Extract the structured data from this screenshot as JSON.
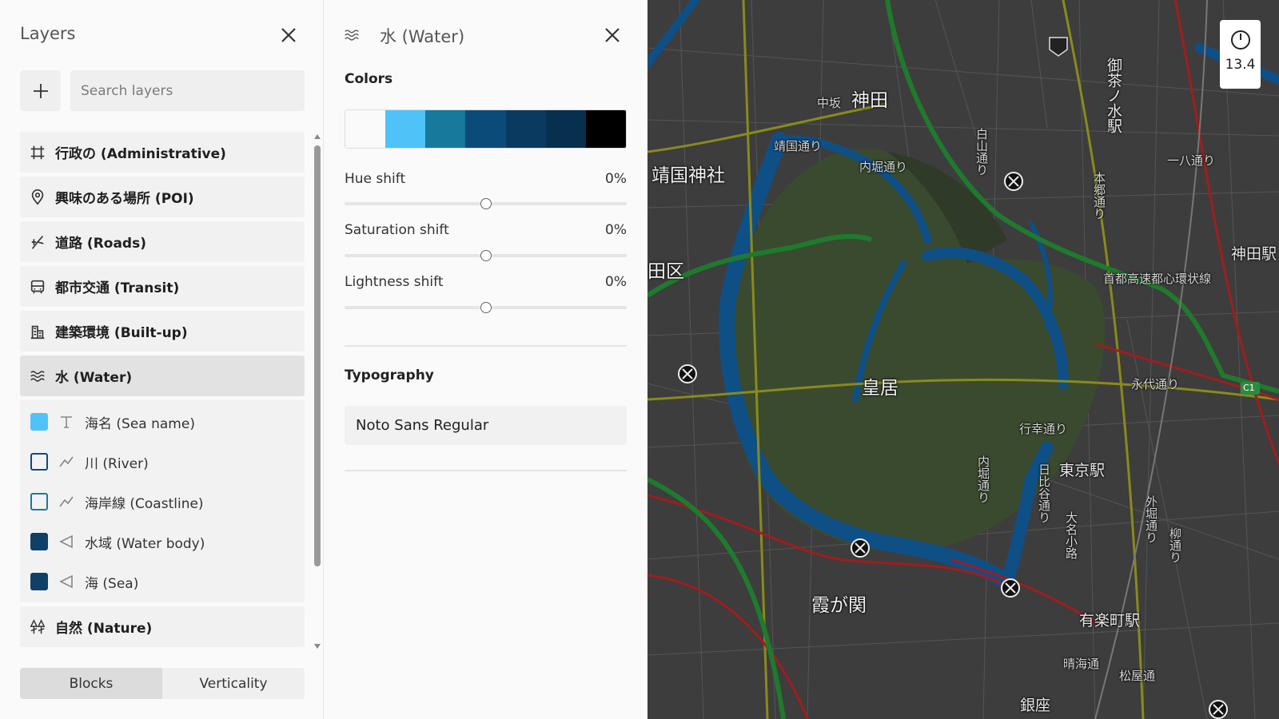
{
  "layers_panel": {
    "title": "Layers",
    "search_placeholder": "Search layers",
    "groups": [
      {
        "label": "行政の (Administrative)",
        "icon": "grid-hash-icon"
      },
      {
        "label": "興味のある場所 (POI)",
        "icon": "map-pin-icon"
      },
      {
        "label": "道路 (Roads)",
        "icon": "road-fork-icon"
      },
      {
        "label": "都市交通 (Transit)",
        "icon": "bus-icon"
      },
      {
        "label": "建築環境 (Built-up)",
        "icon": "buildings-icon"
      },
      {
        "label": "水 (Water)",
        "icon": "waves-icon",
        "active": true
      },
      {
        "label": "自然 (Nature)",
        "icon": "tree-icon"
      }
    ],
    "water_children": [
      {
        "label": "海名 (Sea name)",
        "type": "text-icon",
        "swatch_fill": "#4fc3f7",
        "swatch_border": "#4fc3f7"
      },
      {
        "label": "川 (River)",
        "type": "line-icon",
        "swatch_fill": "transparent",
        "swatch_border": "#0f4c75"
      },
      {
        "label": "海岸線 (Coastline)",
        "type": "line-icon",
        "swatch_fill": "transparent",
        "swatch_border": "#1b7a99"
      },
      {
        "label": "水域 (Water body)",
        "type": "polygon-icon",
        "swatch_fill": "#0e4068",
        "swatch_border": "#0e4068"
      },
      {
        "label": "海 (Sea)",
        "type": "polygon-icon",
        "swatch_fill": "#0e4068",
        "swatch_border": "#0e4068"
      }
    ],
    "modes": [
      "Blocks",
      "Verticality"
    ],
    "selected_mode": "Blocks"
  },
  "detail_panel": {
    "title": "水 (Water)",
    "colors_heading": "Colors",
    "palette": [
      "#fafafa",
      "#4fc3f7",
      "#17799b",
      "#0b4b7a",
      "#0a3a5f",
      "#07304f",
      "#000000"
    ],
    "sliders": [
      {
        "label": "Hue shift",
        "value": "0%",
        "level": 0.5
      },
      {
        "label": "Saturation shift",
        "value": "0%",
        "level": 0.5
      },
      {
        "label": "Lightness shift",
        "value": "0%",
        "level": 0.5
      }
    ],
    "typography_heading": "Typography",
    "font": "Noto Sans Regular"
  },
  "map": {
    "zoom": "13.4",
    "labels": {
      "kanda": "神田",
      "nakasaka": "中坂",
      "yasukuni": "靖国神社",
      "chiyoda": "田区",
      "imperial_palace": "皇居",
      "tokyo_station": "東京駅",
      "kasumigaseki": "霞が関",
      "yurakucho": "有楽町駅",
      "ginza": "銀座",
      "kanda_station": "神田駅",
      "ochanomizu": "御茶ノ水駅",
      "yasukuni_dori": "靖国通り",
      "uchibori": "内堀通り",
      "hakusan": "白山通り",
      "shuto": "首都高速都心環状線",
      "eitai": "永代通り",
      "gyoko": "行幸通り",
      "hibiya": "日比谷通り",
      "uchibori2": "内堀通り",
      "daimyo": "大名小路",
      "sotobori": "外堀通り",
      "hongo": "本郷通り",
      "ichihachi": "一八通り",
      "harumi": "晴海通",
      "matsuya": "松屋通",
      "yanagi": "柳通り",
      "c1": "C1"
    }
  }
}
